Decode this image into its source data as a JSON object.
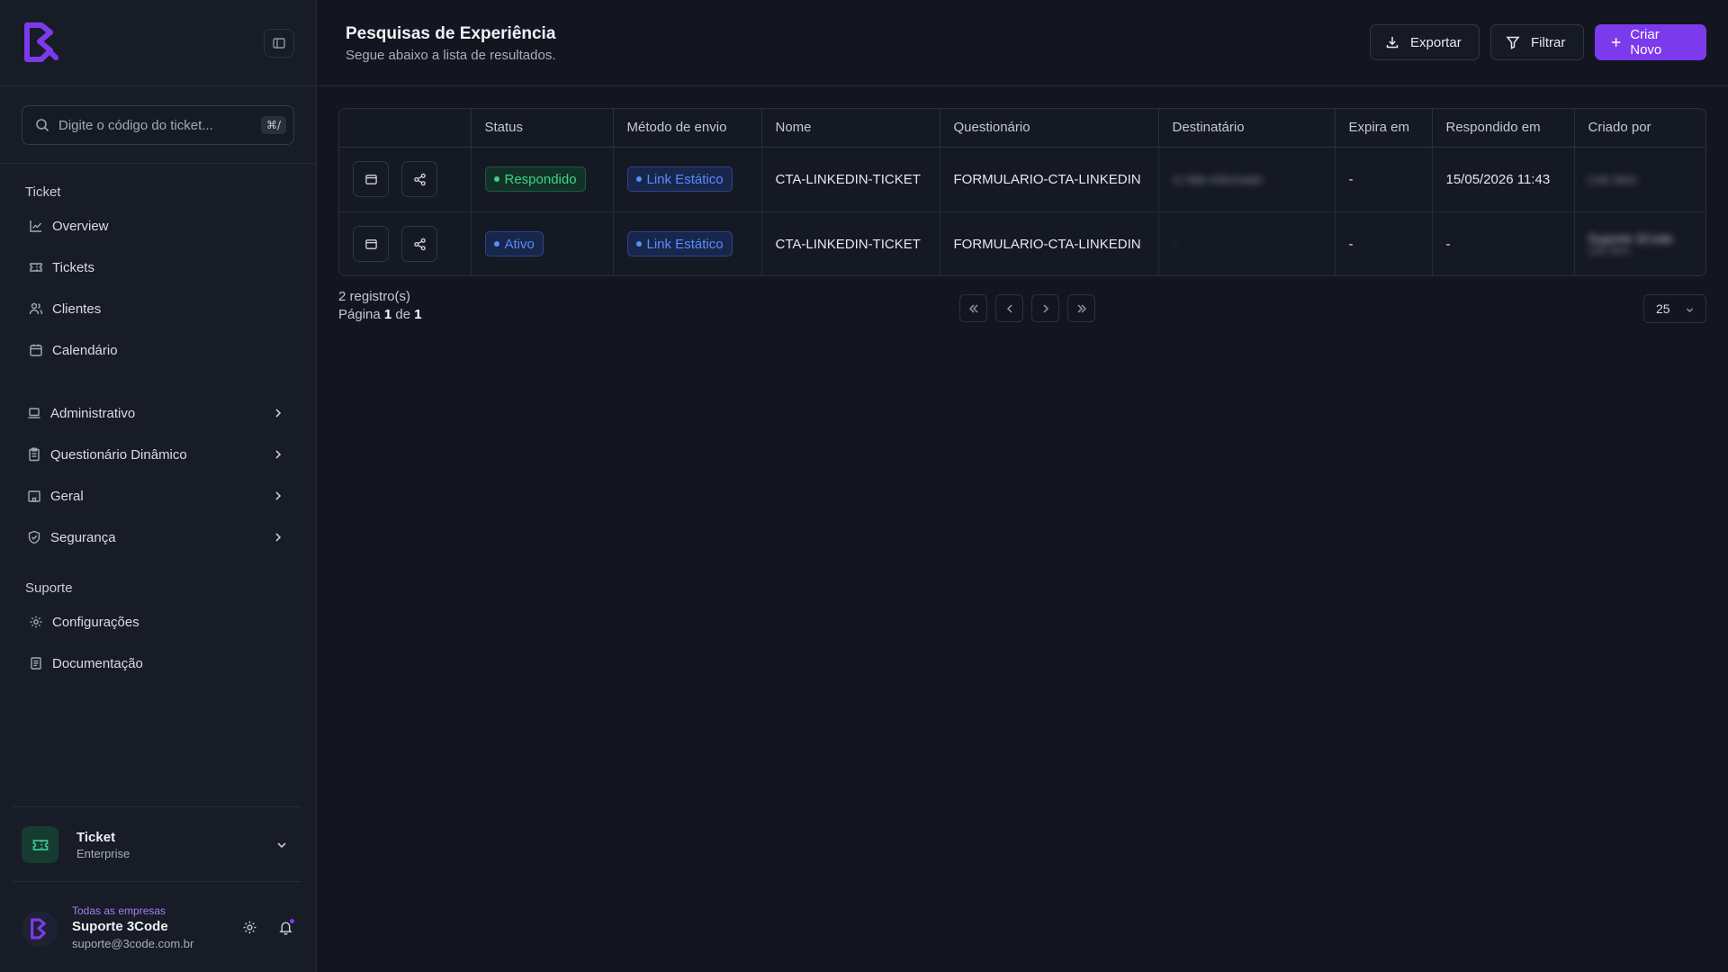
{
  "sidebar": {
    "search": {
      "placeholder": "Digite o código do ticket...",
      "shortcut": "⌘/"
    },
    "section_ticket": "Ticket",
    "items": [
      {
        "label": "Overview",
        "icon": "chart-line-icon"
      },
      {
        "label": "Tickets",
        "icon": "ticket-icon"
      },
      {
        "label": "Clientes",
        "icon": "users-icon"
      },
      {
        "label": "Calendário",
        "icon": "calendar-icon"
      }
    ],
    "groups": [
      {
        "label": "Administrativo",
        "icon": "laptop-icon"
      },
      {
        "label": "Questionário Dinâmico",
        "icon": "clipboard-icon"
      },
      {
        "label": "Geral",
        "icon": "building-icon"
      },
      {
        "label": "Segurança",
        "icon": "shield-icon"
      }
    ],
    "section_support": "Suporte",
    "support_items": [
      {
        "label": "Configurações",
        "icon": "gear-icon"
      },
      {
        "label": "Documentação",
        "icon": "book-icon"
      }
    ],
    "product": {
      "name": "Ticket",
      "plan": "Enterprise"
    },
    "user": {
      "company": "Todas as empresas",
      "name": "Suporte 3Code",
      "email": "suporte@3code.com.br"
    }
  },
  "header": {
    "title": "Pesquisas de Experiência",
    "subtitle": "Segue abaixo a lista de resultados.",
    "export_label": "Exportar",
    "filter_label": "Filtrar",
    "create_label": "Criar Novo"
  },
  "table": {
    "columns": [
      "",
      "Status",
      "Método de envio",
      "Nome",
      "Questionário",
      "Destinatário",
      "Expira em",
      "Respondido em",
      "Criado por"
    ],
    "rows": [
      {
        "status": "Respondido",
        "method": "Link Estático",
        "name": "CTA-LINKEDIN-TICKET",
        "form": "FORMULARIO-CTA-LINKEDIN",
        "recipient": "Não informado",
        "expires": "-",
        "answered": "15/05/2026 11:43",
        "created_by": "Link Sem"
      },
      {
        "status": "Ativo",
        "method": "Link Estático",
        "name": "CTA-LINKEDIN-TICKET",
        "form": "FORMULARIO-CTA-LINKEDIN",
        "recipient": "-",
        "expires": "-",
        "answered": "-",
        "created_by": "Suporte 3Code",
        "created_by_sub": "Link Sem"
      }
    ]
  },
  "footer": {
    "count": "2 registro(s)",
    "page_prefix": "Página",
    "page_current": "1",
    "page_mid": "de",
    "page_total": "1",
    "per_page": "25"
  },
  "colors": {
    "accent": "#7c3aed",
    "success": "#3ecf8e",
    "info": "#5b8cff",
    "background": "#131620",
    "sidebar": "#181c27"
  }
}
